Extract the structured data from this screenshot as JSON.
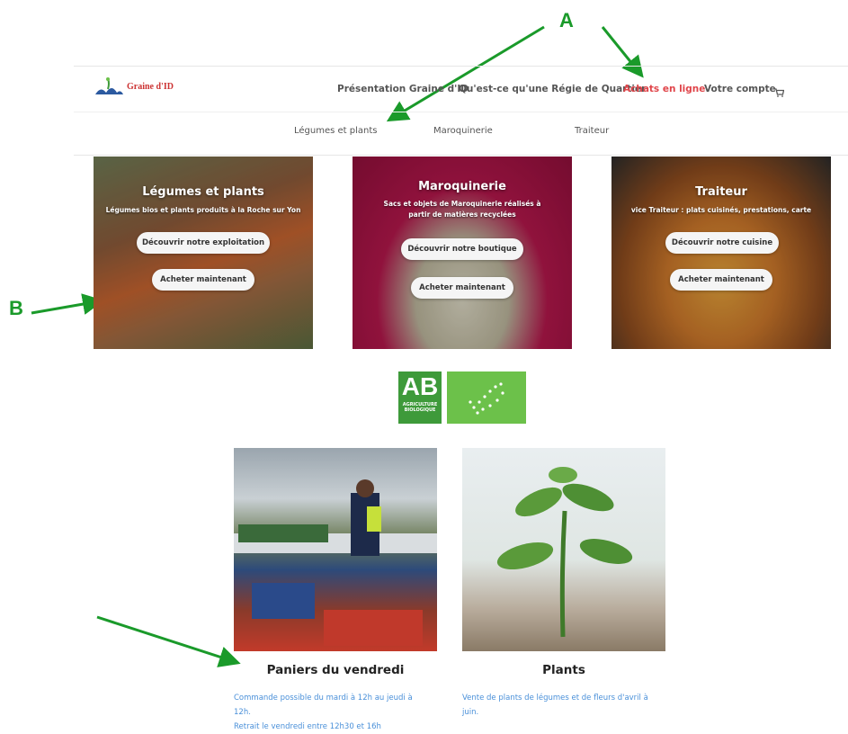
{
  "annotations": {
    "a": "A",
    "b": "B"
  },
  "logo": {
    "brand": "Graine d'ID"
  },
  "nav": {
    "items": [
      {
        "label": "Présentation Graine d'ID"
      },
      {
        "label": "Qu'est-ce qu'une Régie de Quartier"
      },
      {
        "label": "Achats en ligne",
        "active": true
      },
      {
        "label": "Votre compte"
      }
    ],
    "cart_icon": "cart-icon"
  },
  "subnav": {
    "items": [
      "Légumes et plants",
      "Maroquinerie",
      "Traiteur"
    ]
  },
  "cards": [
    {
      "title": "Légumes et plants",
      "subtitle": "Légumes bios et plants produits à la Roche sur Yon",
      "primary": "Découvrir notre exploitation",
      "secondary": "Acheter maintenant"
    },
    {
      "title": "Maroquinerie",
      "subtitle1": "Sacs et objets de Maroquinerie réalisés à",
      "subtitle2": "partir de matières recyclées",
      "primary": "Découvrir notre boutique",
      "secondary": "Acheter maintenant"
    },
    {
      "title": "Traiteur",
      "subtitle": "vice Traiteur : plats cuisinés, prestations, carte",
      "primary": "Découvrir notre cuisine",
      "secondary": "Acheter maintenant"
    }
  ],
  "organic": {
    "ab": "AB",
    "ab_line1": "AGRICULTURE",
    "ab_line2": "BIOLOGIQUE"
  },
  "sections": [
    {
      "title": "Paniers du vendredi",
      "line1": "Commande possible du mardi à 12h au jeudi à",
      "line2": "12h.",
      "line3": "Retrait le vendredi entre 12h30 et 16h"
    },
    {
      "title": "Plants",
      "line1": "Vente de plants de légumes et de fleurs d'avril à",
      "line2": "juin."
    }
  ],
  "colors": {
    "accent": "#e0454a",
    "link": "#4a90d9",
    "annotation": "#1a9a2a"
  }
}
